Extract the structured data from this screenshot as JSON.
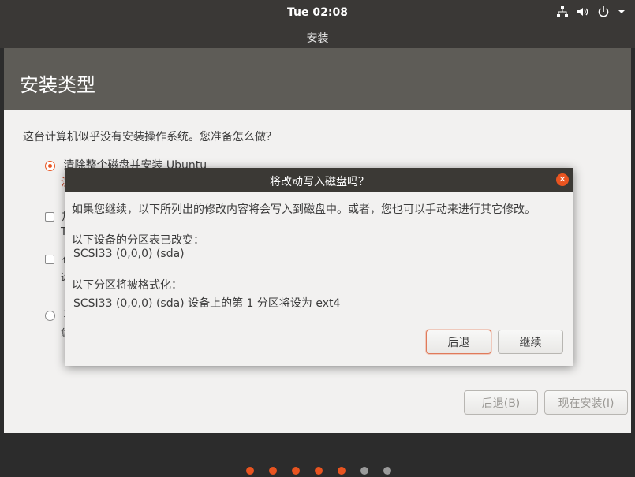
{
  "topbar": {
    "clock": "Tue 02:08"
  },
  "tray_icons": [
    "network-icon",
    "volume-icon",
    "power-icon",
    "chevron-down-icon"
  ],
  "window": {
    "title": "安装"
  },
  "page": {
    "title": "安装类型",
    "question": "这台计算机似乎没有安装操作系统。您准备怎么做？",
    "options": [
      {
        "label": "清除整个磁盘并安装 Ubuntu",
        "sub": "注",
        "selected": true
      },
      {
        "label": "加",
        "sub": "T"
      },
      {
        "label": "在",
        "sub": "这"
      },
      {
        "label": "其",
        "sub": "您"
      }
    ],
    "back_button": "后退(B)",
    "install_button": "现在安装(I)"
  },
  "dialog": {
    "title": "将改动写入磁盘吗？",
    "intro": "如果您继续，以下所列出的修改内容将会写入到磁盘中。或者，您也可以手动来进行其它修改。",
    "partition_table_heading": "以下设备的分区表已改变：",
    "partition_table_device": "SCSI33 (0,0,0) (sda)",
    "format_heading": "以下分区将被格式化：",
    "format_item": "SCSI33 (0,0,0) (sda) 设备上的第 1 分区将设为 ext4",
    "back_button": "后退",
    "continue_button": "继续"
  },
  "progress": {
    "total_steps": 7,
    "completed_steps": 5,
    "accent": "#e95420",
    "inactive": "#9b9b9b"
  }
}
